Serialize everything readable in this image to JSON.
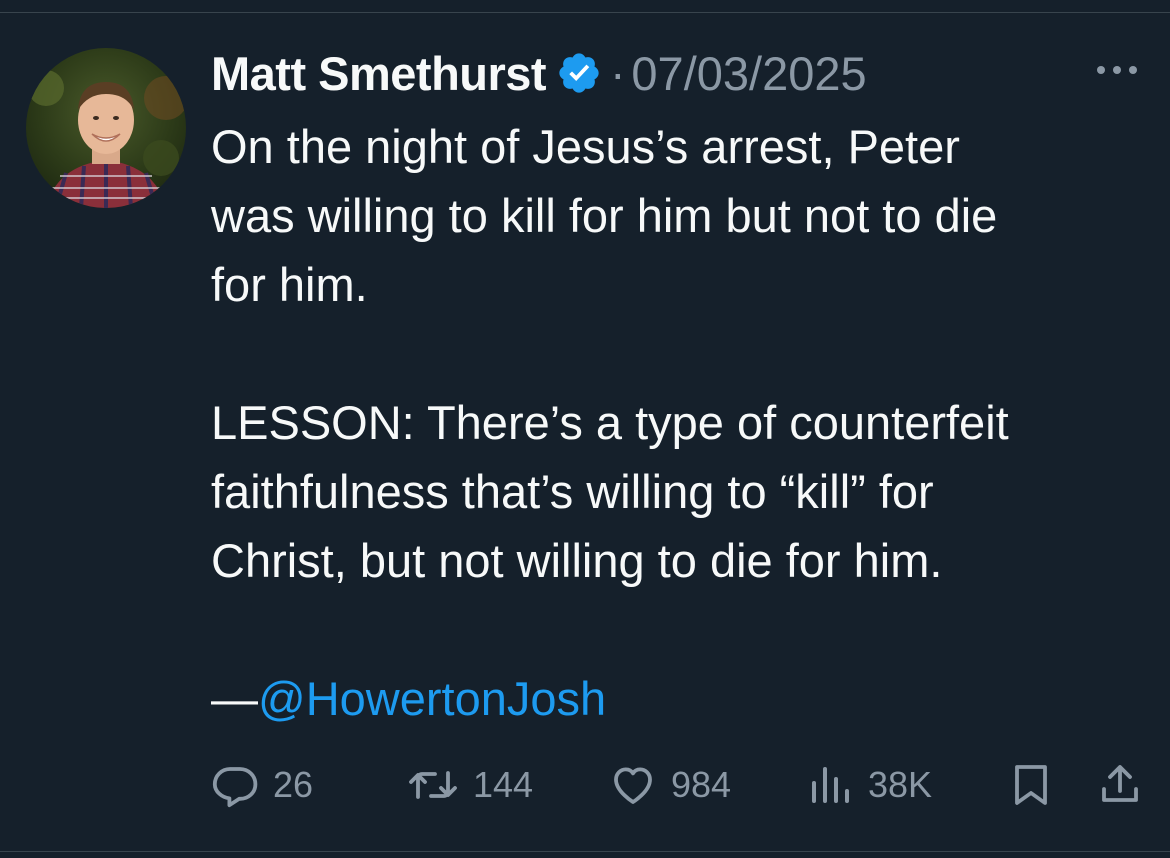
{
  "tweet": {
    "author": {
      "name": "Matt Smethurst",
      "verified_icon": "verified-badge-icon",
      "avatar_icon": "profile-photo"
    },
    "separator": "·",
    "date": "07/03/2025",
    "menu_icon": "more-options-icon",
    "body": {
      "paragraph1": [
        "On the night of Jesus’s arrest, Peter",
        "was willing to kill for him but not to die",
        "for him."
      ],
      "paragraph2": [
        "LESSON: There’s a type of counterfeit",
        "faithfulness that’s willing to “kill” for",
        "Christ, but not willing to die for him."
      ],
      "attribution_dash": "—",
      "mention": "@HowertonJosh"
    },
    "actions": {
      "reply": {
        "icon": "reply-icon",
        "count": "26"
      },
      "retweet": {
        "icon": "retweet-icon",
        "count": "144"
      },
      "like": {
        "icon": "heart-icon",
        "count": "984"
      },
      "views": {
        "icon": "views-chart-icon",
        "count": "38K"
      },
      "bookmark": {
        "icon": "bookmark-icon"
      },
      "share": {
        "icon": "share-icon"
      }
    }
  },
  "colors": {
    "background": "#15202b",
    "text": "#f7f9f9",
    "secondary": "#8b98a5",
    "accent": "#1d9bf0"
  }
}
